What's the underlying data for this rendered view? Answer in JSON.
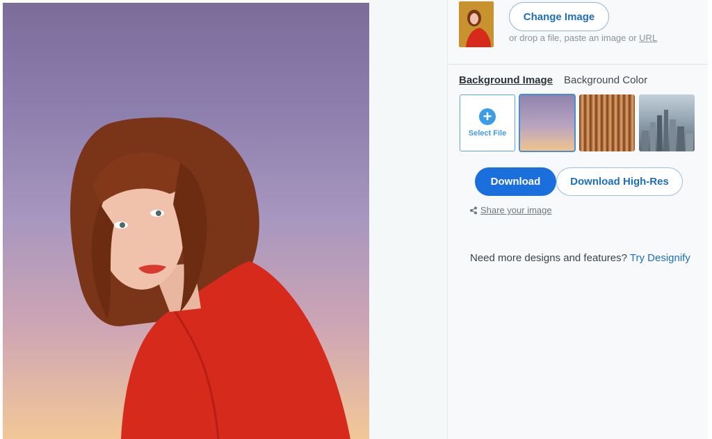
{
  "preview": {
    "icon": "portrait-photo",
    "colors": {
      "sky_top": "#7b6c9a",
      "sky_bottom": "#f2c898",
      "sweater": "#d62a1c",
      "hair": "#7a3418"
    }
  },
  "upload": {
    "change_label": "Change Image",
    "hint_prefix": "or drop a file, paste an image or ",
    "hint_url": "URL"
  },
  "background": {
    "tabs": [
      {
        "label": "Background Image",
        "active": true
      },
      {
        "label": "Background Color",
        "active": false
      }
    ],
    "select_file_label": "Select File",
    "tiles": [
      {
        "name": "gradient",
        "selected": true
      },
      {
        "name": "stripes",
        "selected": false
      },
      {
        "name": "city",
        "selected": false
      }
    ]
  },
  "actions": {
    "download_label": "Download",
    "download_hr_label": "Download High-Res",
    "share_label": "Share your image",
    "accent": "#1b6fdc"
  },
  "promo": {
    "text": "Need more designs and features? ",
    "link": "Try Designify"
  }
}
